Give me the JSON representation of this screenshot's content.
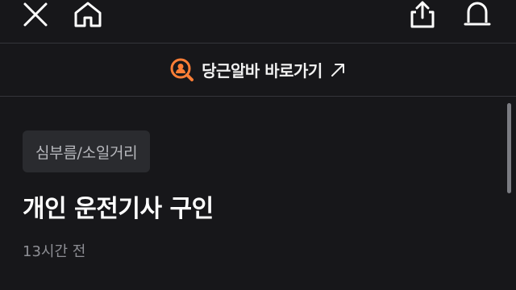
{
  "header": {
    "close_icon": "close-icon",
    "home_icon": "home-icon",
    "share_icon": "share-icon",
    "alarm_icon": "alarm-icon"
  },
  "banner": {
    "label": "당근알바 바로가기",
    "logo_icon": "job-search-icon",
    "arrow_icon": "arrow-up-right-icon",
    "logo_color": "#ff7e36"
  },
  "post": {
    "category": "심부름/소일거리",
    "title": "개인 운전기사 구인",
    "timestamp": "13시간 전"
  },
  "colors": {
    "background": "#17171a",
    "divider": "#34353a",
    "chip_bg": "#2a2b2f",
    "muted_text": "#8e8f95"
  }
}
